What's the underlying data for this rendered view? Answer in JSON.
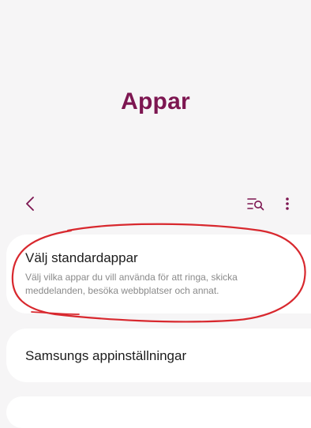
{
  "header": {
    "title": "Appar"
  },
  "toolbar": {
    "back_icon": "chevron-left-icon",
    "search_icon": "list-search-icon",
    "more_icon": "more-vertical-icon"
  },
  "list": {
    "items": [
      {
        "title": "Välj standardappar",
        "description": "Välj vilka appar du vill använda för att ringa, skicka meddelanden, besöka webbplatser och annat."
      },
      {
        "title": "Samsungs appinställningar"
      }
    ]
  },
  "colors": {
    "title": "#7d1651",
    "background": "#f6f5f6",
    "card": "#ffffff",
    "annotation": "#d8282e"
  }
}
